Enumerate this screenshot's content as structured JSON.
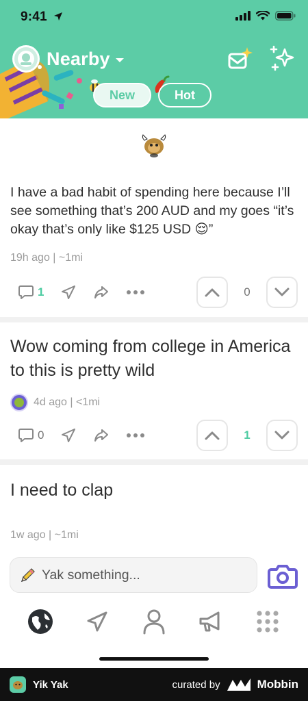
{
  "status_bar": {
    "time": "9:41"
  },
  "header": {
    "location_title": "Nearby",
    "tabs": [
      {
        "label": "New",
        "active": true
      },
      {
        "label": "Hot",
        "active": false
      }
    ]
  },
  "posts": [
    {
      "text": "I have a bad habit of spending here because I’ll see something that’s 200 AUD and my goes “it’s okay that’s only like $125 USD 😌”",
      "meta": "19h ago | ~1mi",
      "comments": "1",
      "votes": "0"
    },
    {
      "text": "Wow coming from college in America to this is pretty wild",
      "meta": "4d ago | <1mi",
      "comments": "0",
      "votes": "1"
    },
    {
      "text": "I need to clap",
      "meta": "1w ago | ~1mi"
    }
  ],
  "composer": {
    "placeholder": "Yak something..."
  },
  "footer": {
    "app_name": "Yik Yak",
    "curated_by": "curated by",
    "brand": "Mobbin"
  },
  "colors": {
    "header_bg": "#5ccca6",
    "accent_teal": "#4ccba1",
    "camera_purple": "#6b5fd3",
    "footer_bg": "#111111"
  },
  "icons": {
    "header": [
      "avatar-badge-icon",
      "chevron-down-icon",
      "inbox-sparkle-icon",
      "sparkles-icon"
    ],
    "post_actions": [
      "comment-icon",
      "send-icon",
      "share-icon",
      "more-icon",
      "upvote-icon",
      "downvote-icon"
    ],
    "nav": [
      "globe-icon",
      "send-nav-icon",
      "profile-icon",
      "megaphone-icon",
      "grid-icon"
    ]
  }
}
